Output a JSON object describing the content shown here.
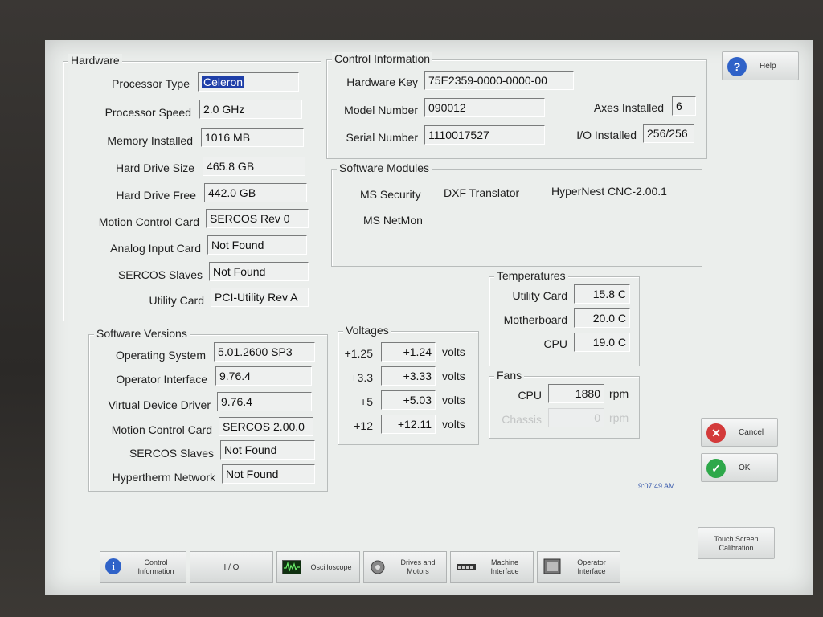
{
  "hardware": {
    "title": "Hardware",
    "rows": [
      {
        "label": "Processor Type",
        "value": "Celeron"
      },
      {
        "label": "Processor Speed",
        "value": "2.0 GHz"
      },
      {
        "label": "Memory Installed",
        "value": "1016 MB"
      },
      {
        "label": "Hard Drive Size",
        "value": "465.8 GB"
      },
      {
        "label": "Hard Drive Free",
        "value": "442.0 GB"
      },
      {
        "label": "Motion Control Card",
        "value": "SERCOS Rev 0"
      },
      {
        "label": "Analog Input Card",
        "value": "Not Found"
      },
      {
        "label": "SERCOS Slaves",
        "value": "Not Found"
      },
      {
        "label": "Utility Card",
        "value": "PCI-Utility Rev A"
      }
    ]
  },
  "control_info": {
    "title": "Control Information",
    "hardware_key_label": "Hardware Key",
    "hardware_key": "75E2359-0000-0000-00",
    "model_number_label": "Model Number",
    "model_number": "090012",
    "serial_number_label": "Serial Number",
    "serial_number": "1110017527",
    "axes_label": "Axes Installed",
    "axes": "6",
    "io_label": "I/O Installed",
    "io": "256/256"
  },
  "software_modules": {
    "title": "Software Modules",
    "items": [
      "MS Security",
      "DXF Translator",
      "HyperNest CNC-2.00.1",
      "MS NetMon"
    ]
  },
  "software_versions": {
    "title": "Software Versions",
    "rows": [
      {
        "label": "Operating System",
        "value": "5.01.2600 SP3"
      },
      {
        "label": "Operator Interface",
        "value": "9.76.4"
      },
      {
        "label": "Virtual Device Driver",
        "value": "9.76.4"
      },
      {
        "label": "Motion Control Card",
        "value": "SERCOS 2.00.0"
      },
      {
        "label": "SERCOS Slaves",
        "value": "Not Found"
      },
      {
        "label": "Hypertherm Network",
        "value": "Not Found"
      }
    ]
  },
  "voltages": {
    "title": "Voltages",
    "unit": "volts",
    "rows": [
      {
        "label": "+1.25",
        "value": "+1.24"
      },
      {
        "label": "+3.3",
        "value": "+3.33"
      },
      {
        "label": "+5",
        "value": "+5.03"
      },
      {
        "label": "+12",
        "value": "+12.11"
      }
    ]
  },
  "temperatures": {
    "title": "Temperatures",
    "rows": [
      {
        "label": "Utility Card",
        "value": "15.8 C"
      },
      {
        "label": "Motherboard",
        "value": "20.0 C"
      },
      {
        "label": "CPU",
        "value": "19.0 C"
      }
    ]
  },
  "fans": {
    "title": "Fans",
    "unit": "rpm",
    "rows": [
      {
        "label": "CPU",
        "value": "1880"
      },
      {
        "label": "Chassis",
        "value": "0"
      }
    ]
  },
  "buttons": {
    "help": "Help",
    "cancel": "Cancel",
    "ok": "OK",
    "touch_screen_calibration": "Touch Screen Calibration"
  },
  "clock": "9:07:49 AM",
  "tabs": [
    {
      "label": "Control Information"
    },
    {
      "label": "I / O"
    },
    {
      "label": "Oscilloscope"
    },
    {
      "label": "Drives and Motors"
    },
    {
      "label": "Machine Interface"
    },
    {
      "label": "Operator Interface"
    }
  ],
  "colors": {
    "selection": "#1f3fa8",
    "help_icon": "#2f62c8",
    "cancel_icon": "#d33a3a",
    "ok_icon": "#2ea84a"
  }
}
